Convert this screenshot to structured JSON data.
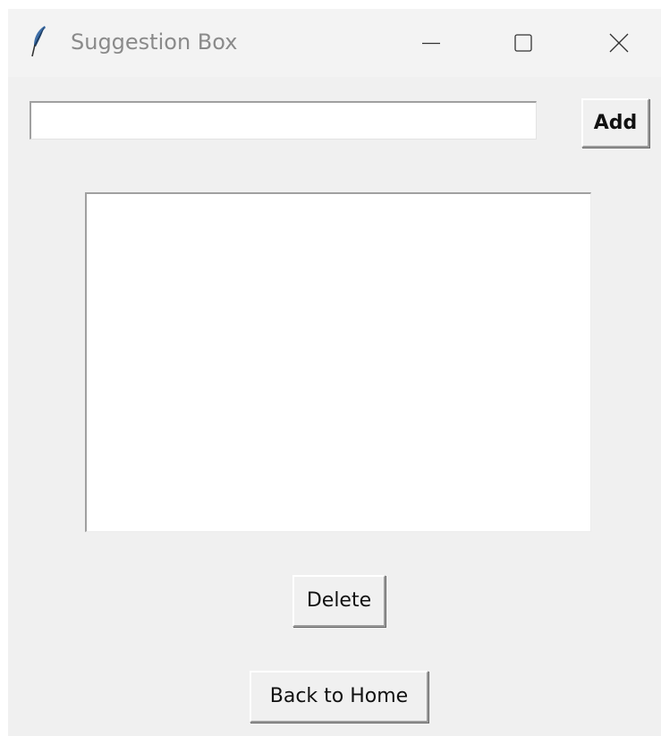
{
  "window": {
    "title": "Suggestion Box",
    "icon": "feather-icon",
    "controls": {
      "minimize": "minimize-icon",
      "maximize": "maximize-icon",
      "close": "close-icon"
    }
  },
  "form": {
    "entry_value": "",
    "add_label": "Add"
  },
  "suggestions": {
    "items": []
  },
  "actions": {
    "delete_label": "Delete",
    "back_label": "Back to Home"
  },
  "colors": {
    "window_bg": "#f0f0f0",
    "titlebar_bg": "#f3f3f3",
    "title_text": "#8a8a8a",
    "feather_blue": "#3f6fa8"
  }
}
